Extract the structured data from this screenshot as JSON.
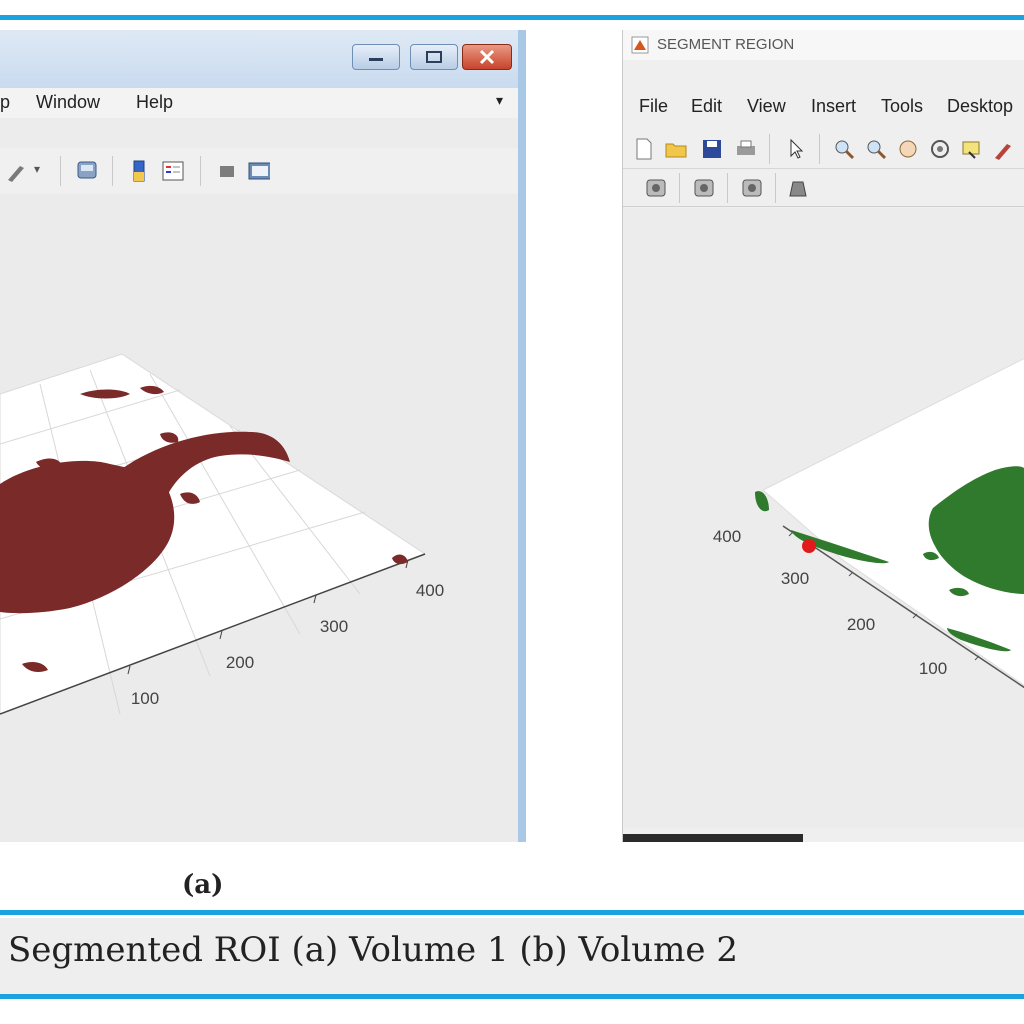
{
  "window_a": {
    "menu": [
      "p",
      "Window",
      "Help"
    ],
    "menu_overflow": "▾",
    "axis_ticks": [
      "100",
      "200",
      "300",
      "400"
    ],
    "region_color": "#7a2a28"
  },
  "window_b": {
    "title": "SEGMENT REGION",
    "menu": [
      "File",
      "Edit",
      "View",
      "Insert",
      "Tools",
      "Desktop"
    ],
    "axis_ticks_left": [
      "400",
      "300",
      "200",
      "100"
    ],
    "region_color": "#2f7a2d",
    "marker_color": "#e11b1b"
  },
  "caption": {
    "panel_label_a": "(a)",
    "text": "Segmented ROI (a) Volume 1 (b) Volume 2"
  },
  "accent_color": "#1aa3e0"
}
